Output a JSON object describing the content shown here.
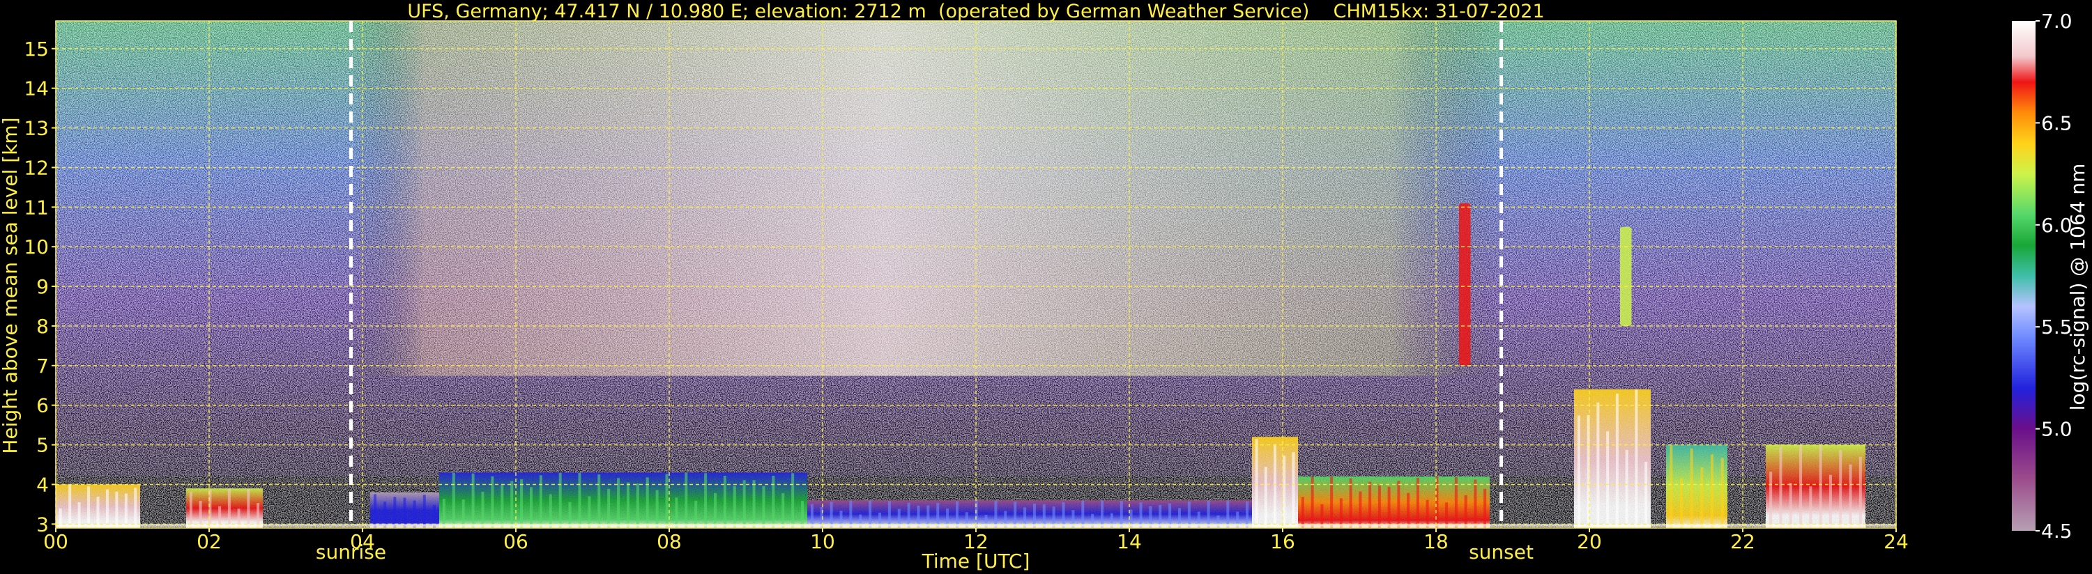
{
  "chart_data": {
    "type": "heatmap",
    "title": "UFS, Germany; 47.417 N / 10.980 E; elevation: 2712 m  (operated by German Weather Service)    CHM15kx: 31-07-2021",
    "xlabel": "Time [UTC]",
    "ylabel": "Height above mean sea level [km]",
    "xlim": [
      0,
      24
    ],
    "ylim": [
      2.9,
      15.7
    ],
    "x_ticks": [
      "00",
      "02",
      "04",
      "06",
      "08",
      "10",
      "12",
      "14",
      "16",
      "18",
      "20",
      "22",
      "24"
    ],
    "y_ticks": [
      "3",
      "4",
      "5",
      "6",
      "7",
      "8",
      "9",
      "10",
      "11",
      "12",
      "13",
      "14",
      "15"
    ],
    "grid": true,
    "colorbar": {
      "label": "log(rc-signal) @ 1064 nm",
      "range": [
        4.5,
        7.0
      ],
      "ticks": [
        "4.5",
        "5.0",
        "5.5",
        "6.0",
        "6.5",
        "7.0"
      ]
    },
    "events": [
      {
        "label": "sunrise",
        "time": 3.85
      },
      {
        "label": "sunset",
        "time": 18.85
      }
    ],
    "boundary_layer_signal": [
      {
        "start": 0.0,
        "end": 1.1,
        "top": 4.0,
        "level": 6.9
      },
      {
        "start": 1.7,
        "end": 2.7,
        "top": 3.9,
        "level": 6.8
      },
      {
        "start": 4.1,
        "end": 5.0,
        "top": 3.8,
        "level": 5.2
      },
      {
        "start": 5.0,
        "end": 9.8,
        "top": 4.3,
        "level": 5.9
      },
      {
        "start": 9.8,
        "end": 15.6,
        "top": 3.6,
        "level": 5.4
      },
      {
        "start": 15.6,
        "end": 16.2,
        "top": 5.2,
        "level": 6.9
      },
      {
        "start": 16.2,
        "end": 18.7,
        "top": 4.2,
        "level": 6.6
      },
      {
        "start": 19.8,
        "end": 20.8,
        "top": 6.4,
        "level": 6.9
      },
      {
        "start": 21.0,
        "end": 21.8,
        "top": 5.0,
        "level": 6.3
      },
      {
        "start": 22.3,
        "end": 23.6,
        "top": 5.0,
        "level": 6.8
      }
    ],
    "elevated_layers": [
      {
        "start": 18.3,
        "end": 18.45,
        "bottom": 7.0,
        "top": 11.1,
        "level": 6.7
      },
      {
        "start": 20.4,
        "end": 20.55,
        "bottom": 8.0,
        "top": 10.5,
        "level": 6.3
      }
    ]
  }
}
